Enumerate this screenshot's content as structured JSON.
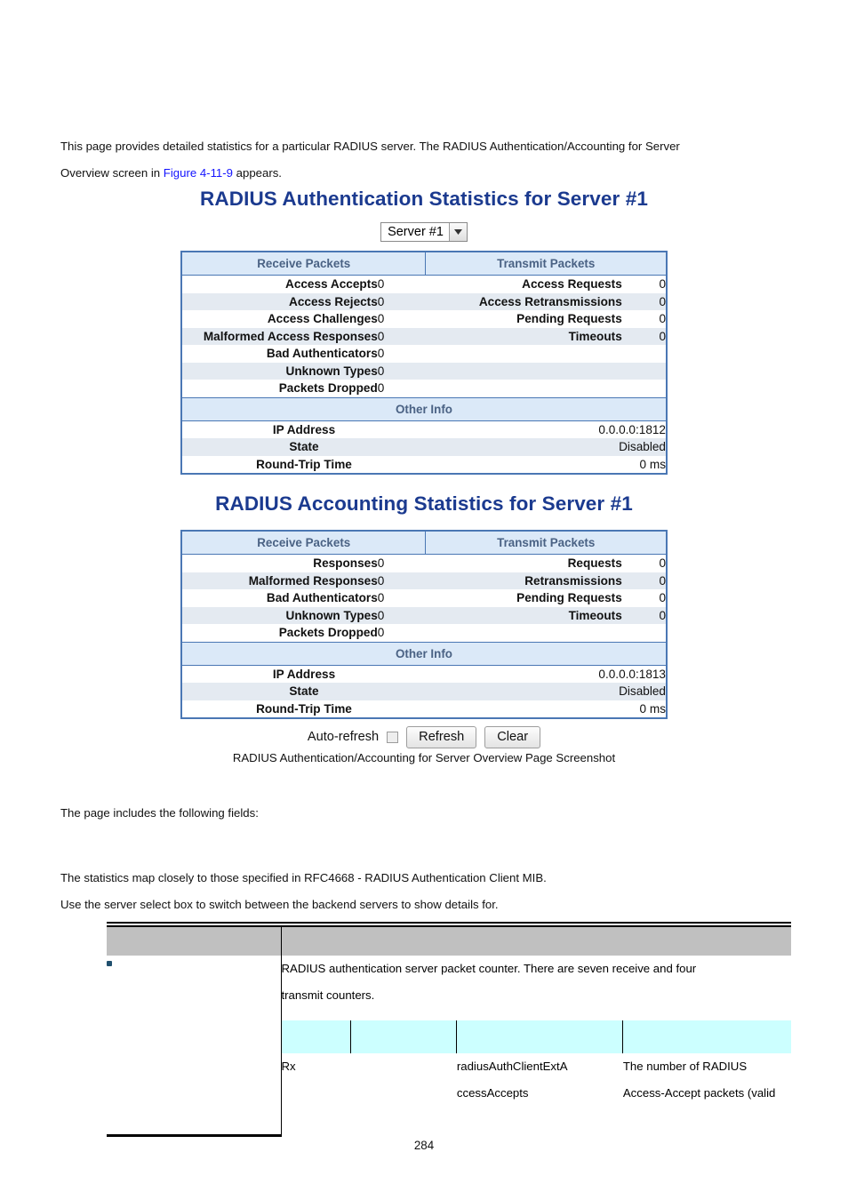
{
  "intro": {
    "line1_before": "This page provides detailed statistics for a particular RADIUS server. The RADIUS Authentication/Accounting for Server",
    "line2_before": "Overview screen in ",
    "link": "Figure 4-11-9",
    "line2_after": " appears."
  },
  "screenshot": {
    "auth": {
      "title": "RADIUS Authentication Statistics for Server #1",
      "server_select": {
        "value": "Server #1",
        "options": [
          "Server #1"
        ]
      },
      "headers": {
        "receive": "Receive Packets",
        "transmit": "Transmit Packets",
        "other": "Other Info"
      },
      "receive_rows": [
        {
          "label": "Access Accepts",
          "value": "0"
        },
        {
          "label": "Access Rejects",
          "value": "0"
        },
        {
          "label": "Access Challenges",
          "value": "0"
        },
        {
          "label": "Malformed Access Responses",
          "value": "0"
        },
        {
          "label": "Bad Authenticators",
          "value": "0"
        },
        {
          "label": "Unknown Types",
          "value": "0"
        },
        {
          "label": "Packets Dropped",
          "value": "0"
        }
      ],
      "transmit_rows": [
        {
          "label": "Access Requests",
          "value": "0"
        },
        {
          "label": "Access Retransmissions",
          "value": "0"
        },
        {
          "label": "Pending Requests",
          "value": "0"
        },
        {
          "label": "Timeouts",
          "value": "0"
        },
        {
          "label": "",
          "value": ""
        },
        {
          "label": "",
          "value": ""
        },
        {
          "label": "",
          "value": ""
        }
      ],
      "other_rows": [
        {
          "label": "IP Address",
          "value": "0.0.0.0:1812"
        },
        {
          "label": "State",
          "value": "Disabled"
        },
        {
          "label": "Round-Trip Time",
          "value": "0 ms"
        }
      ]
    },
    "acct": {
      "title": "RADIUS Accounting Statistics for Server #1",
      "headers": {
        "receive": "Receive Packets",
        "transmit": "Transmit Packets",
        "other": "Other Info"
      },
      "receive_rows": [
        {
          "label": "Responses",
          "value": "0"
        },
        {
          "label": "Malformed Responses",
          "value": "0"
        },
        {
          "label": "Bad Authenticators",
          "value": "0"
        },
        {
          "label": "Unknown Types",
          "value": "0"
        },
        {
          "label": "Packets Dropped",
          "value": "0"
        }
      ],
      "transmit_rows": [
        {
          "label": "Requests",
          "value": "0"
        },
        {
          "label": "Retransmissions",
          "value": "0"
        },
        {
          "label": "Pending Requests",
          "value": "0"
        },
        {
          "label": "Timeouts",
          "value": "0"
        },
        {
          "label": "",
          "value": ""
        }
      ],
      "other_rows": [
        {
          "label": "IP Address",
          "value": "0.0.0.0:1813"
        },
        {
          "label": "State",
          "value": "Disabled"
        },
        {
          "label": "Round-Trip Time",
          "value": "0 ms"
        }
      ]
    },
    "controls": {
      "auto_refresh_label": "Auto-refresh",
      "auto_refresh_checked": false,
      "refresh_label": "Refresh",
      "clear_label": "Clear"
    }
  },
  "caption": "RADIUS Authentication/Accounting for Server Overview Page Screenshot",
  "paragraphs": {
    "fields_intro": "The page includes the following fields:",
    "stats_map": "The statistics map closely to those specified in RFC4668 - RADIUS Authentication Client MIB.",
    "server_select": "Use the server select box to switch between the backend servers to show details for."
  },
  "field_table": {
    "head_col1": "",
    "head_col2": "",
    "desc_line1": "RADIUS authentication server packet counter. There are seven receive and four",
    "desc_line2": "transmit counters.",
    "inner_head": [
      "",
      "",
      "",
      ""
    ],
    "inner_row": {
      "direction": "Rx",
      "name": "",
      "mib_line1": "radiusAuthClientExtA",
      "mib_line2": "ccessAccepts",
      "desc_line1": "The number of RADIUS",
      "desc_line2": "Access-Accept packets (valid"
    }
  },
  "page_number": "284"
}
